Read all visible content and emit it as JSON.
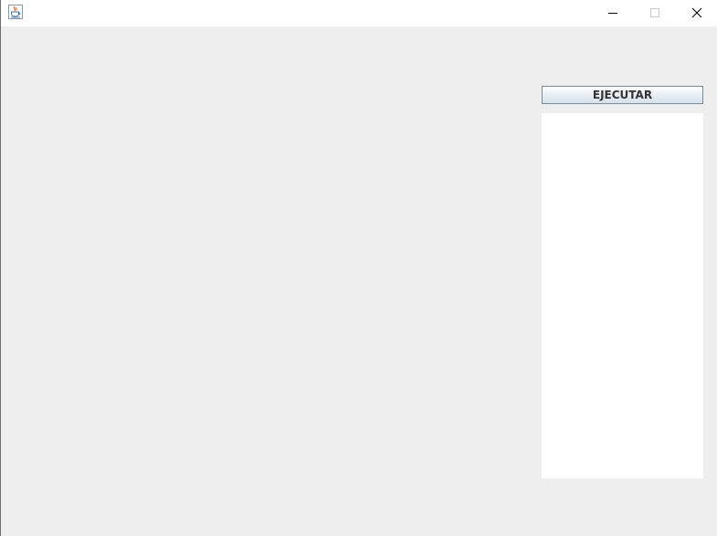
{
  "titlebar": {
    "title": "",
    "icon": "java-coffee-cup-icon",
    "controls": {
      "minimize": "minimize-icon",
      "maximize": "maximize-icon",
      "close": "close-icon"
    }
  },
  "main": {
    "run_button_label": "EJECUTAR",
    "output_text": ""
  },
  "colors": {
    "background": "#eeeeee",
    "titlebar": "#ffffff",
    "button_border": "#7a8a99",
    "output_background": "#ffffff"
  }
}
